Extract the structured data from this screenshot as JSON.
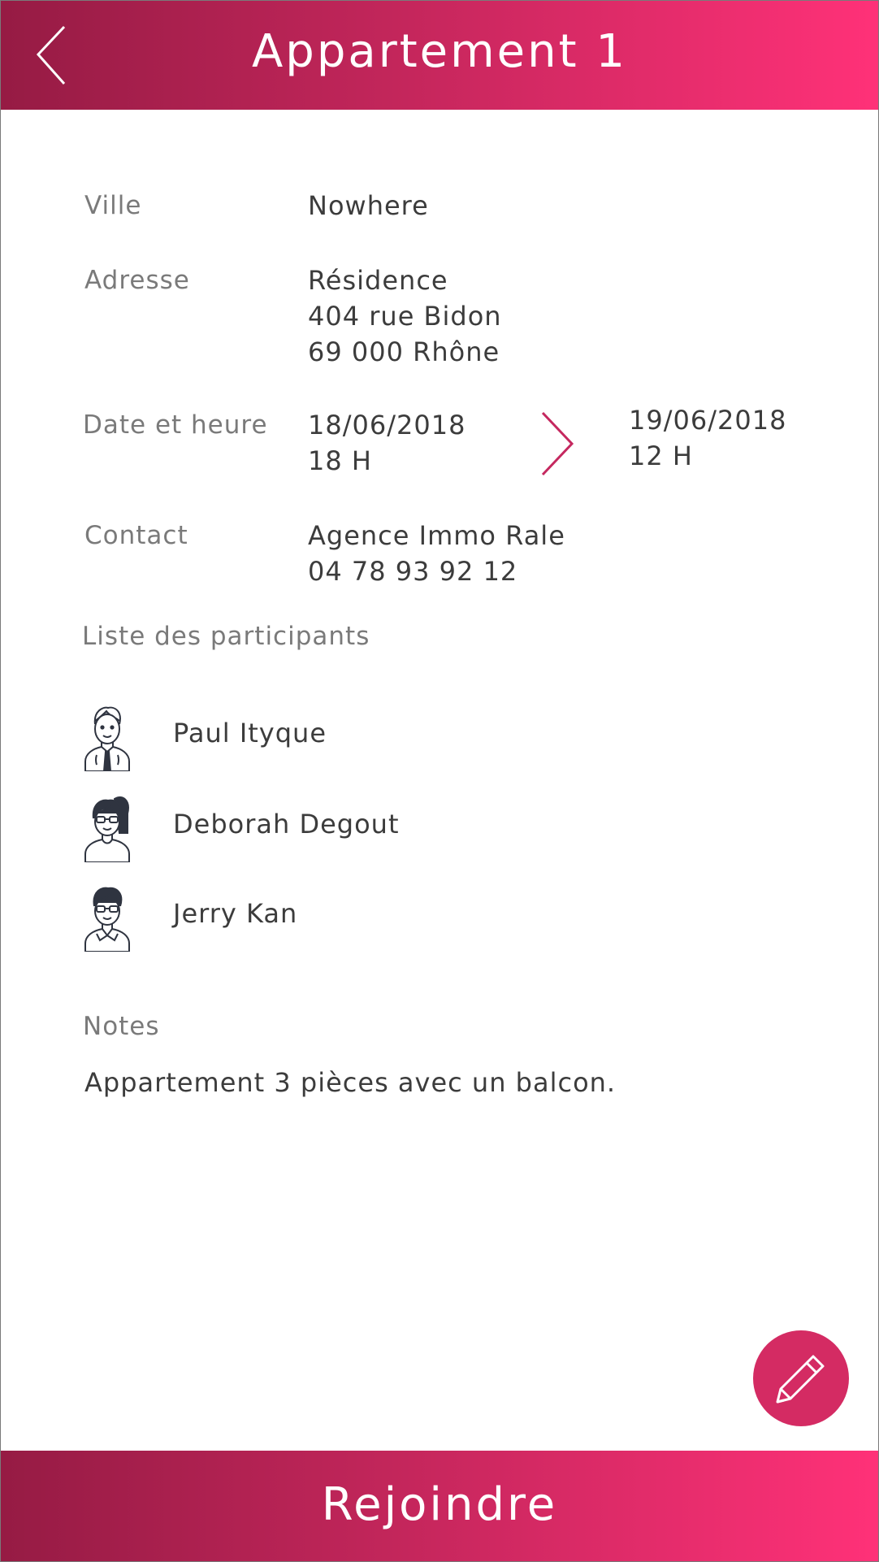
{
  "header": {
    "title": "Appartement 1",
    "back_icon": "chevron-left-icon"
  },
  "details": {
    "city_label": "Ville",
    "city_value": "Nowhere",
    "address_label": "Adresse",
    "address_line1": "Résidence",
    "address_line2": "404 rue Bidon",
    "address_line3": "69 000 Rhône",
    "datetime_label": "Date et heure",
    "start_date": "18/06/2018",
    "start_hour": "18 H",
    "end_date": "19/06/2018",
    "end_hour": "12 H",
    "range_icon": "chevron-right-icon",
    "contact_label": "Contact",
    "contact_name": "Agence Immo Rale",
    "contact_phone": "04 78 93 92 12"
  },
  "participants": {
    "section_label": "Liste des participants",
    "items": [
      {
        "name": "Paul Ityque",
        "avatar": "man-tie-avatar-icon"
      },
      {
        "name": "Deborah Degout",
        "avatar": "woman-glasses-avatar-icon"
      },
      {
        "name": "Jerry Kan",
        "avatar": "man-glasses-avatar-icon"
      }
    ]
  },
  "notes": {
    "label": "Notes",
    "text": "Appartement 3 pièces avec un balcon."
  },
  "edit_button": {
    "icon": "pencil-icon"
  },
  "footer": {
    "join_label": "Rejoindre"
  },
  "colors": {
    "gradient_start": "#961b44",
    "gradient_end": "#ff3178",
    "accent": "#d42b63",
    "label_gray": "#7a7a7a",
    "text_dark": "#3c3c3c"
  }
}
